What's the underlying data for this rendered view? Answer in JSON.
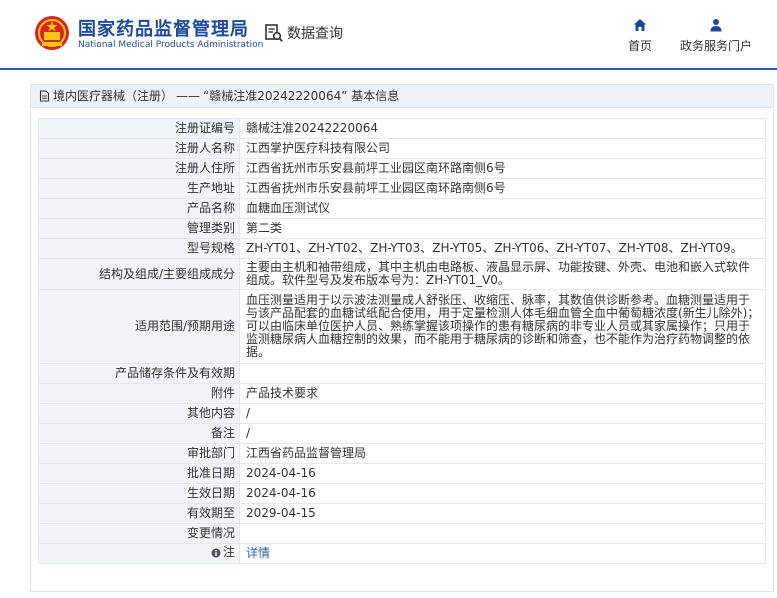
{
  "header": {
    "title": "国家药品监督管理局",
    "subtitle": "National Medical Products Administration",
    "data_query": "数据查询",
    "nav": [
      {
        "label": "首页",
        "icon": "home-icon"
      },
      {
        "label": "政务服务门户",
        "icon": "user-icon"
      }
    ],
    "colors": {
      "brand": "#1d4b9c",
      "emblem": "#d8261f"
    }
  },
  "breadcrumb": {
    "section": "境内医疗器械（注册）",
    "separator": "——",
    "current": "“赣械注准20242220064” 基本信息"
  },
  "rows": [
    {
      "label": "注册证编号",
      "value": "赣械注准20242220064"
    },
    {
      "label": "注册人名称",
      "value": "江西掌护医疗科技有限公司"
    },
    {
      "label": "注册人住所",
      "value": "江西省抚州市乐安县前坪工业园区南环路南侧6号"
    },
    {
      "label": "生产地址",
      "value": "江西省抚州市乐安县前坪工业园区南环路南侧6号"
    },
    {
      "label": "产品名称",
      "value": "血糖血压测试仪"
    },
    {
      "label": "管理类别",
      "value": "第二类"
    },
    {
      "label": "型号规格",
      "value": "ZH-YT01、ZH-YT02、ZH-YT03、ZH-YT05、ZH-YT06、ZH-YT07、ZH-YT08、ZH-YT09。"
    },
    {
      "label": "结构及组成/主要组成成分",
      "value": "主要由主机和袖带组成，其中主机由电路板、液晶显示屏、功能按键、外壳、电池和嵌入式软件组成。软件型号及发布版本号为：ZH-YT01_V0。"
    },
    {
      "label": "适用范围/预期用途",
      "value": "血压测量适用于以示波法测量成人舒张压、收缩压、脉率，其数值供诊断参考。血糖测量适用于与该产品配套的血糖试纸配合使用，用于定量检测人体毛细血管全血中葡萄糖浓度(新生儿除外)；可以由临床单位医护人员、熟练掌握该项操作的患有糖尿病的非专业人员或其家属操作；只用于监测糖尿病人血糖控制的效果，而不能用于糖尿病的诊断和筛查，也不能作为治疗药物调整的依据。"
    },
    {
      "label": "产品储存条件及有效期",
      "value": ""
    },
    {
      "label": "附件",
      "value": "产品技术要求"
    },
    {
      "label": "其他内容",
      "value": "/"
    },
    {
      "label": "备注",
      "value": "/"
    },
    {
      "label": "审批部门",
      "value": "江西省药品监督管理局"
    },
    {
      "label": "批准日期",
      "value": "2024-04-16"
    },
    {
      "label": "生效日期",
      "value": "2024-04-16"
    },
    {
      "label": "有效期至",
      "value": "2029-04-15"
    },
    {
      "label": "变更情况",
      "value": ""
    }
  ],
  "note_row": {
    "label": "注",
    "icon": "info-icon",
    "value": "详情"
  }
}
